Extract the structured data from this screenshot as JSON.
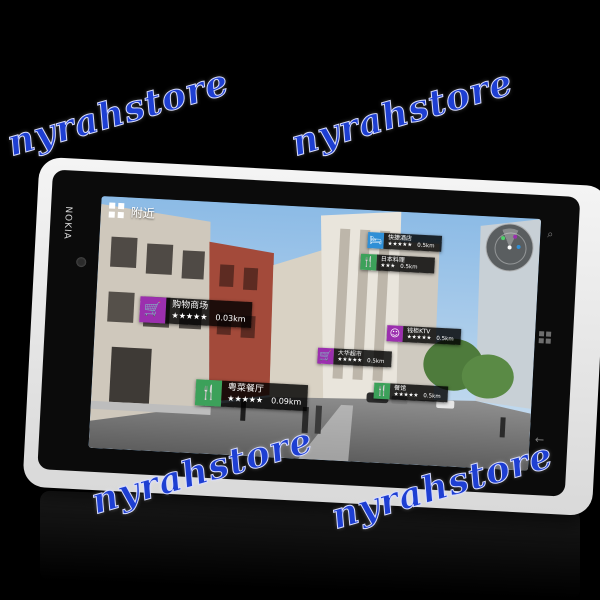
{
  "watermark": {
    "text_top_left": "nyrahstore",
    "text_top_right": "nyrahstore",
    "text_bottom_left": "nyrahstore",
    "text_bottom_right": "nyrahstore",
    "color": "#1e3fd2"
  },
  "device": {
    "brand": "NOKIA",
    "body_color": "#ececec"
  },
  "app": {
    "top_label": "附近",
    "grid_icon": "grid-icon",
    "radar_icon": "radar-icon"
  },
  "places": [
    {
      "id": "shopping-mall",
      "icon": "cart-icon",
      "icon_glyph": "🛒",
      "color": "#9b2fae",
      "title": "购物商场",
      "stars": "★★★★★",
      "distance": "0.03km"
    },
    {
      "id": "chinese-restaurant",
      "icon": "fork-knife-icon",
      "icon_glyph": "🍴",
      "color": "#3ca15a",
      "title": "粤菜餐厅",
      "stars": "★★★★★",
      "distance": "0.09km"
    },
    {
      "id": "hotel",
      "icon": "bed-icon",
      "icon_glyph": "🛏",
      "color": "#2f8fd6",
      "title": "快捷酒店",
      "stars": "★★★★★",
      "distance": "0.5km"
    },
    {
      "id": "japanese-restaurant",
      "icon": "fork-knife-icon",
      "icon_glyph": "🍴",
      "color": "#3ca15a",
      "title": "日本料理",
      "stars": "★★★",
      "distance": "0.5km"
    },
    {
      "id": "ktv",
      "icon": "mask-icon",
      "icon_glyph": "☺",
      "color": "#9b2fae",
      "title": "钱柜KTV",
      "stars": "★★★★★",
      "distance": "0.5km"
    },
    {
      "id": "supermarket",
      "icon": "cart-icon",
      "icon_glyph": "🛒",
      "color": "#9b2fae",
      "title": "大华超市",
      "stars": "★★★★★",
      "distance": "0.5km"
    },
    {
      "id": "diner",
      "icon": "fork-knife-icon",
      "icon_glyph": "🍴",
      "color": "#3ca15a",
      "title": "餐馆",
      "stars": "★★★★★",
      "distance": "0.5km"
    }
  ]
}
